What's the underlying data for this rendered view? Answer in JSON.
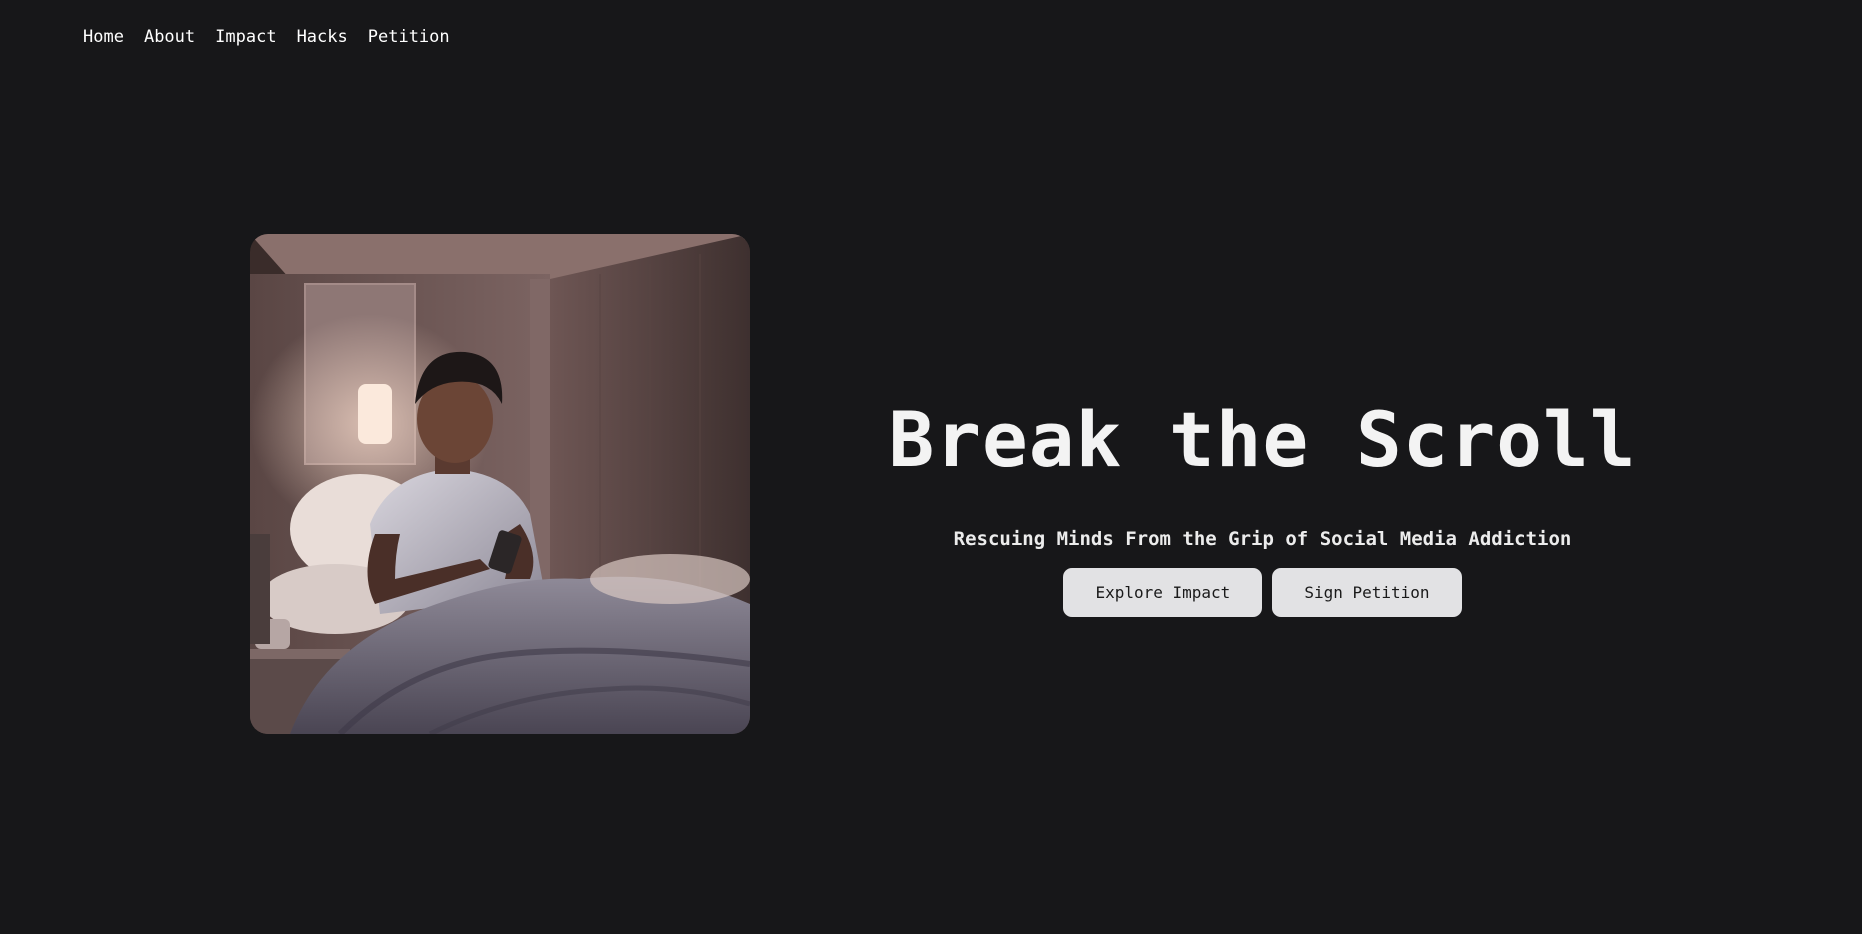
{
  "nav": {
    "items": [
      {
        "label": "Home"
      },
      {
        "label": "About"
      },
      {
        "label": "Impact"
      },
      {
        "label": "Hacks"
      },
      {
        "label": "Petition"
      }
    ]
  },
  "hero": {
    "image_alt": "",
    "title": "Break the Scroll",
    "subtitle": "Rescuing Minds From the Grip of Social Media Addiction",
    "buttons": {
      "primary": "Explore Impact",
      "secondary": "Sign Petition"
    }
  },
  "colors": {
    "background": "#171719",
    "button_bg": "#e2e2e4",
    "text": "#f3f3f3"
  }
}
